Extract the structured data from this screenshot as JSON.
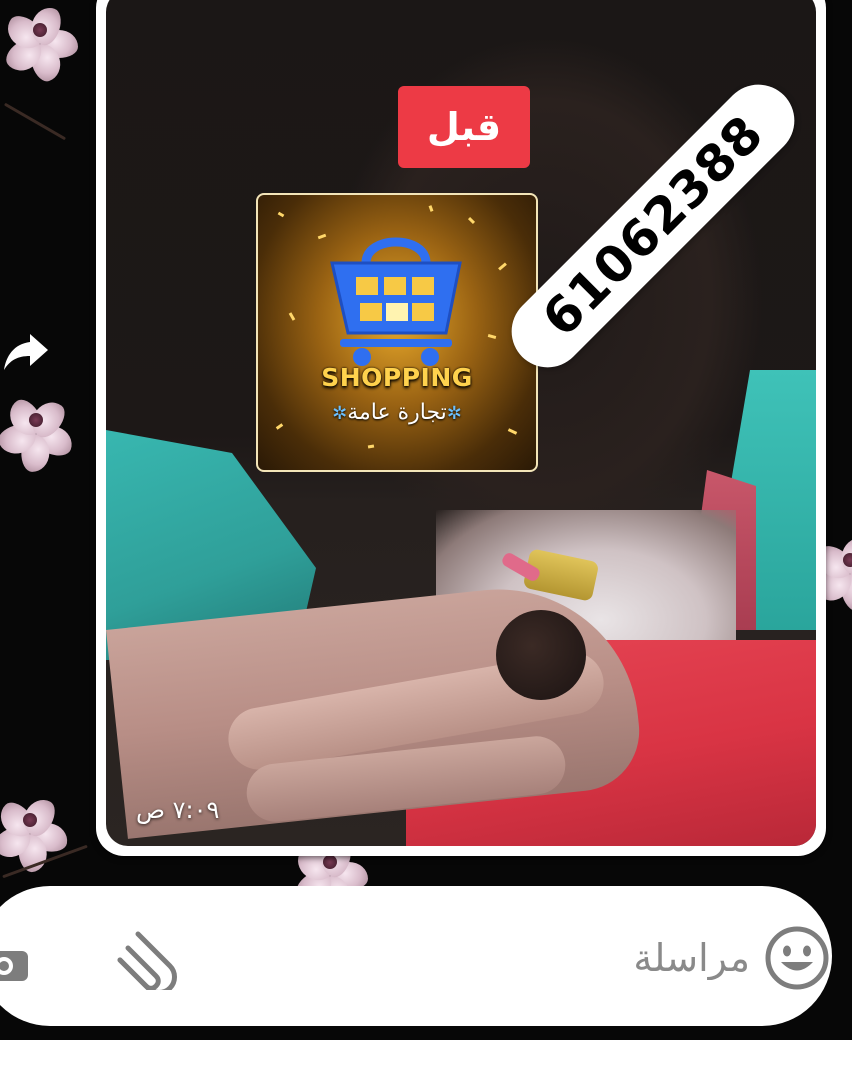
{
  "message": {
    "overlay_label": "قبل",
    "phone_number": "61062388",
    "logo": {
      "brand": "SHOPPING",
      "subtitle": "تجارة عامة"
    },
    "timestamp": "٧:٠٩ ص"
  },
  "composer": {
    "placeholder": "مراسلة",
    "icons": {
      "emoji": "emoji-icon",
      "attach": "paperclip-icon",
      "camera": "camera-icon"
    }
  },
  "forward": {
    "icon": "forward-icon"
  },
  "colors": {
    "label_red": "#ed3a45",
    "logo_gold": "#ffd24d",
    "basket_blue": "#2f6ff0",
    "bubble_bg": "#ffffff"
  }
}
